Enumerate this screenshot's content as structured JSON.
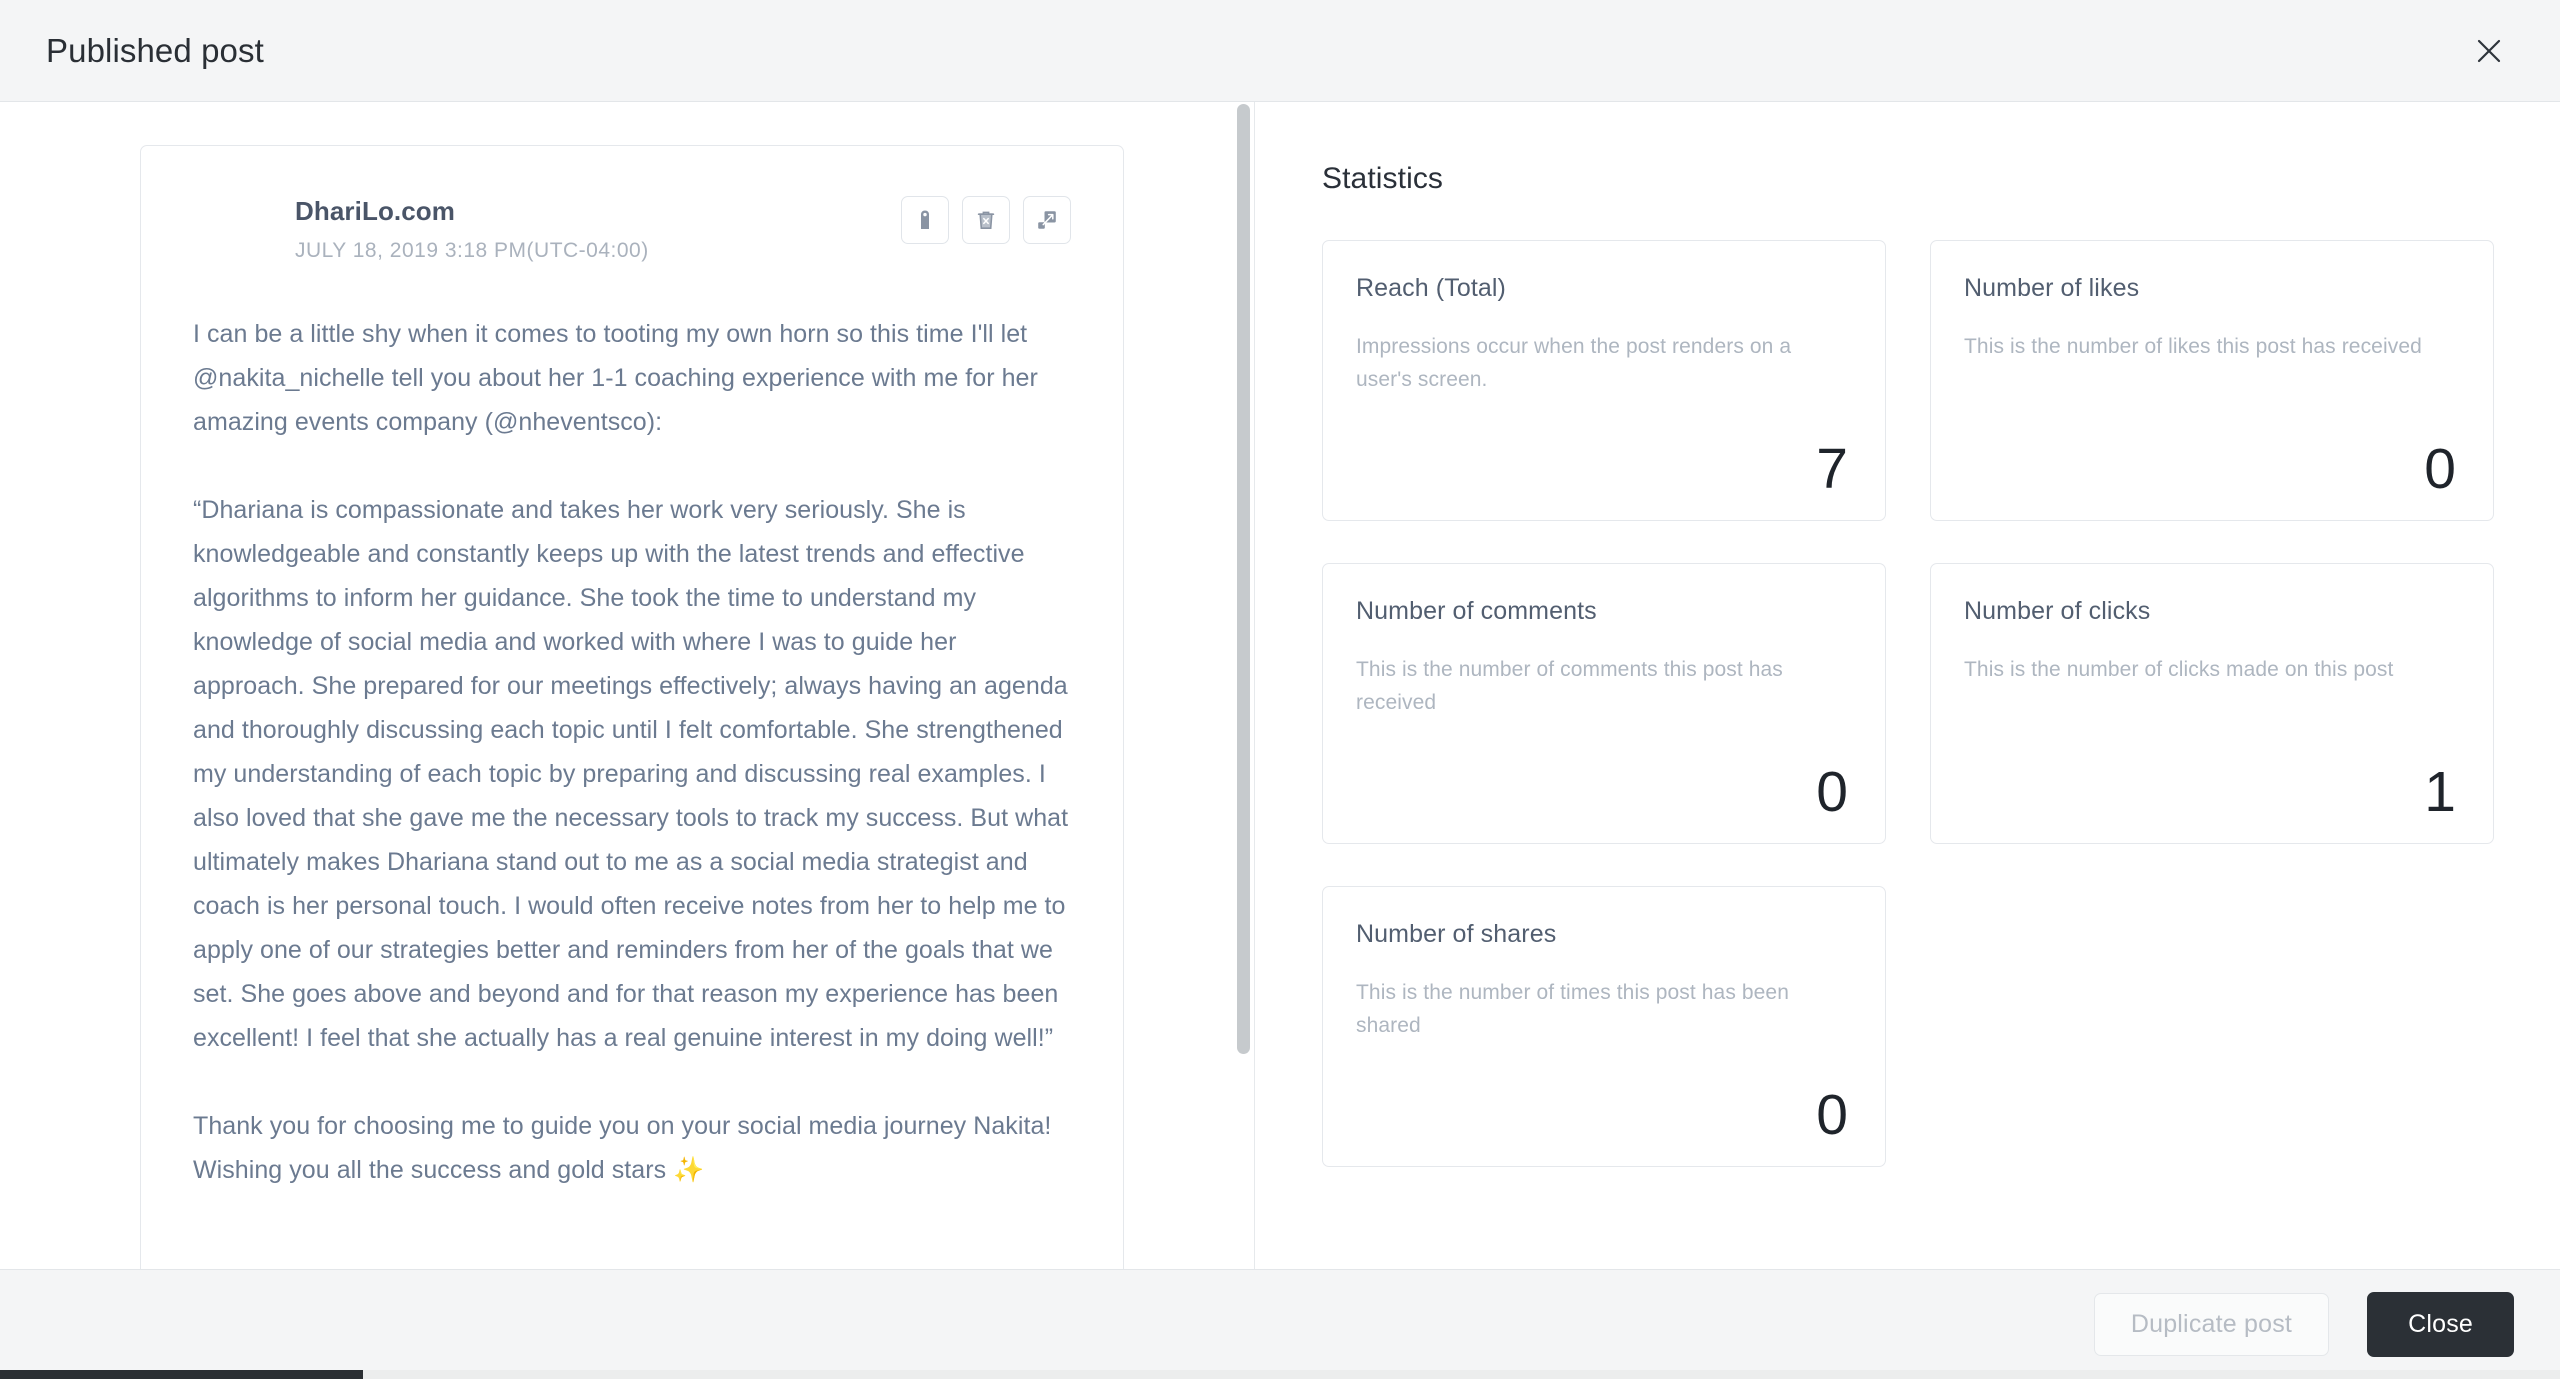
{
  "header": {
    "title": "Published post",
    "close_icon": "close-icon"
  },
  "post": {
    "author": "DhariLo.com",
    "date": "JULY 18, 2019 3:18 PM(UTC-04:00)",
    "actions": [
      {
        "name": "tag-icon",
        "label": "Tag post"
      },
      {
        "name": "delete-icon",
        "label": "Delete post"
      },
      {
        "name": "expand-icon",
        "label": "Expand preview"
      }
    ],
    "paragraphs": [
      "I can be a little shy when it comes to tooting my own horn so this time I'll let @nakita_nichelle tell you about her 1-1 coaching experience with me for her amazing events company (@nheventsco):",
      "“Dhariana is compassionate and takes her work very seriously. She is knowledgeable and constantly keeps up with the latest trends and effective algorithms to inform her guidance. She took the time to understand my knowledge of social media and worked with where I was to guide her approach. She prepared for our meetings effectively; always having an agenda and thoroughly discussing each topic until I felt comfortable. She strengthened my understanding of each topic by preparing and discussing real examples. I also loved that she gave me the necessary tools to track my success. But what ultimately makes Dhariana stand out to me as a social media strategist and coach is her personal touch. I would often receive notes from her to help me to apply one of our strategies better and reminders from her of the goals that we set. She goes above and beyond and for that reason my experience has been excellent! I feel that she actually has a real genuine interest in my doing well!”",
      "Thank you for choosing me to guide you on your social media journey Nakita! Wishing you all the success and gold stars ✨"
    ]
  },
  "statistics": {
    "title": "Statistics",
    "cards": [
      {
        "label": "Reach (Total)",
        "description": "Impressions occur when the post renders on a user's screen.",
        "value": "7"
      },
      {
        "label": "Number of likes",
        "description": "This is the number of likes this post has received",
        "value": "0"
      },
      {
        "label": "Number of comments",
        "description": "This is the number of comments this post has received",
        "value": "0"
      },
      {
        "label": "Number of clicks",
        "description": "This is the number of clicks made on this post",
        "value": "1"
      },
      {
        "label": "Number of shares",
        "description": "This is the number of times this post has been shared",
        "value": "0"
      }
    ]
  },
  "footer": {
    "duplicate_label": "Duplicate post",
    "close_label": "Close"
  },
  "colors": {
    "chrome_bg": "#f4f5f6",
    "border": "#e5e8ec",
    "primary_button": "#2b3036",
    "body_text": "#6b7a90",
    "muted_text": "#aeb6c0",
    "value_text": "#1f242b"
  }
}
